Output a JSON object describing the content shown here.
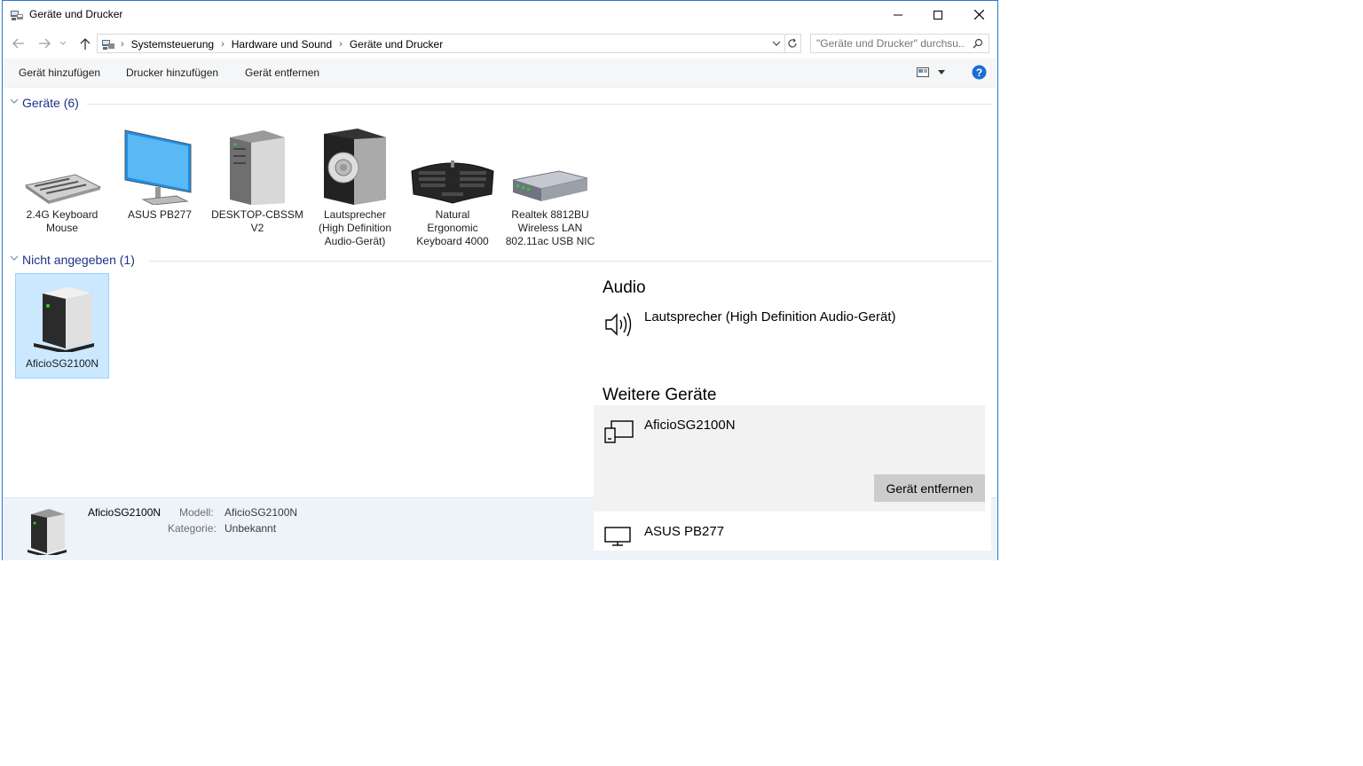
{
  "window": {
    "title": "Geräte und Drucker"
  },
  "address": {
    "crumbs": [
      "Systemsteuerung",
      "Hardware und Sound",
      "Geräte und Drucker"
    ],
    "search_placeholder": "\"Geräte und Drucker\" durchsu..."
  },
  "toolbar": {
    "add_device": "Gerät hinzufügen",
    "add_printer": "Drucker hinzufügen",
    "remove_device": "Gerät entfernen"
  },
  "groups": {
    "devices_label": "Geräte (6)",
    "unspecified_label": "Nicht angegeben (1)"
  },
  "devices": [
    {
      "line1": "2.4G Keyboard",
      "line2": "Mouse",
      "line3": ""
    },
    {
      "line1": "ASUS PB277",
      "line2": "",
      "line3": ""
    },
    {
      "line1": "DESKTOP-CBSSM",
      "line2": "V2",
      "line3": ""
    },
    {
      "line1": "Lautsprecher",
      "line2": "(High Definition",
      "line3": "Audio-Gerät)"
    },
    {
      "line1": "Natural",
      "line2": "Ergonomic",
      "line3": "Keyboard 4000"
    },
    {
      "line1": "Realtek 8812BU",
      "line2": "Wireless LAN",
      "line3": "802.11ac USB NIC"
    }
  ],
  "unspecified": [
    {
      "name": "AficioSG2100N"
    }
  ],
  "details": {
    "name": "AficioSG2100N",
    "model_label": "Modell:",
    "model_value": "AficioSG2100N",
    "category_label": "Kategorie:",
    "category_value": "Unbekannt"
  },
  "panel": {
    "audio_heading": "Audio",
    "audio_device": "Lautsprecher (High Definition Audio-Gerät)",
    "other_heading": "Weitere Geräte",
    "other_device_1": "AficioSG2100N",
    "remove_button": "Gerät entfernen",
    "other_device_2": "ASUS PB277"
  },
  "colors": {
    "accent": "#2b79c2",
    "group_text": "#1e3287",
    "selection": "#cce8ff"
  }
}
